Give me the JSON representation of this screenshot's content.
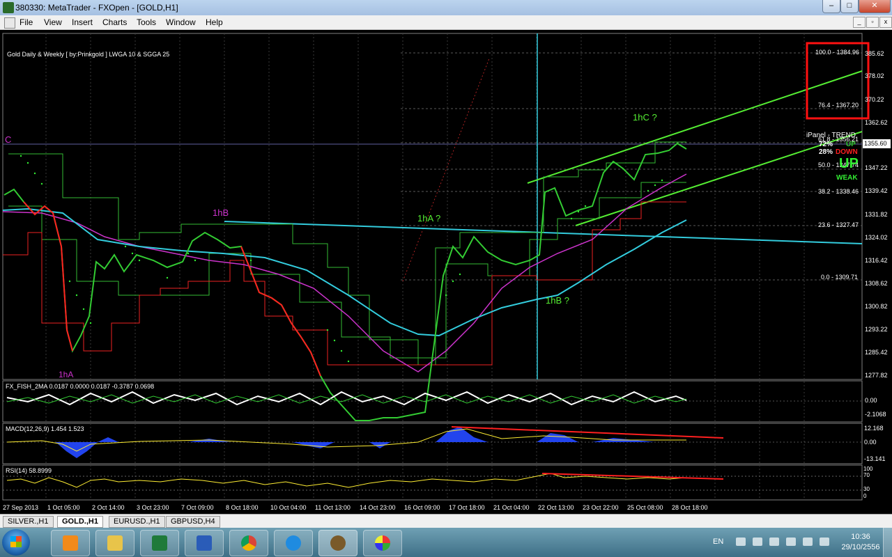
{
  "window": {
    "title": "380330: MetaTrader - FXOpen - [GOLD,H1]",
    "min_glyph": "–",
    "max_glyph": "□",
    "close_glyph": "✕"
  },
  "menu": [
    "File",
    "View",
    "Insert",
    "Charts",
    "Tools",
    "Window",
    "Help"
  ],
  "mdi_buttons": [
    "_",
    "▫",
    "x"
  ],
  "chart": {
    "header": "Gold Daily & Weekly [ by:Prinkgold ] LWGA 10  &  SGGA 25",
    "price_tag": "1355.60",
    "y_ticks": [
      "385.62",
      "378.02",
      "370.22",
      "1362.62",
      "1347.22",
      "1339.42",
      "1331.82",
      "1324.02",
      "1316.42",
      "1308.62",
      "1300.82",
      "1293.22",
      "1285.42",
      "1277.82"
    ],
    "x_ticks": [
      "27 Sep 2013",
      "1 Oct 05:00",
      "2 Oct 14:00",
      "3 Oct 23:00",
      "7 Oct 09:00",
      "8 Oct 18:00",
      "10 Oct 04:00",
      "11 Oct 13:00",
      "14 Oct 23:00",
      "16 Oct 09:00",
      "17 Oct 18:00",
      "21 Oct 04:00",
      "22 Oct 13:00",
      "23 Oct 22:00",
      "25 Oct 08:00",
      "28 Oct 18:00"
    ],
    "fib_labels": [
      "100.0 - 1384.96",
      "76.4 - 1367.20",
      "61.8 - 1356.21",
      "50.0 - 1347.74",
      "38.2 - 1338.46",
      "23.6 - 1327.47",
      "0.0 - 1309.71"
    ],
    "waves": {
      "c": "C",
      "wave_1ha": "1hA",
      "wave_1hb": "1hB",
      "wave_1ha_q": "1hA ?",
      "wave_1hb_q": "1hB ?",
      "wave_1hc_q": "1hC ?"
    },
    "ipanel": {
      "title": "iPanel - TREND",
      "pct1": "72%",
      "pct2": "28%",
      "up_small": "UP",
      "down": "DOWN",
      "up_big": "UP",
      "weak": "WEAK"
    },
    "fish": {
      "label": "FX_FISH_2MA 0.0187 0.0000 0.0187 -0.3787 0.0698",
      "ticks": [
        "0.00",
        "-2.1068"
      ]
    },
    "macd": {
      "label": "MACD(12,26,9) 1.454 1.523",
      "ticks": [
        "12.168",
        "0.00",
        "-13.141"
      ]
    },
    "rsi": {
      "label": "RSI(14) 58.8999",
      "ticks": [
        "100",
        "70",
        "30",
        "0"
      ]
    },
    "colors": {
      "bull": "#33cc33",
      "bear": "#ff2020",
      "channel": "#55ee33",
      "cyan": "#33ccdd",
      "magenta": "#cc33cc",
      "fib_box": "#ff1111"
    }
  },
  "tabs": [
    "SILVER.,H1",
    "GOLD.,H1",
    "EURUSD.,H1",
    "GBPUSD,H4"
  ],
  "taskbar": {
    "lang": "EN",
    "time": "10:36",
    "date": "29/10/2556",
    "apps": [
      "media-player",
      "file-explorer",
      "excel",
      "word",
      "chrome",
      "internet-explorer",
      "metatrader",
      "paint"
    ]
  }
}
